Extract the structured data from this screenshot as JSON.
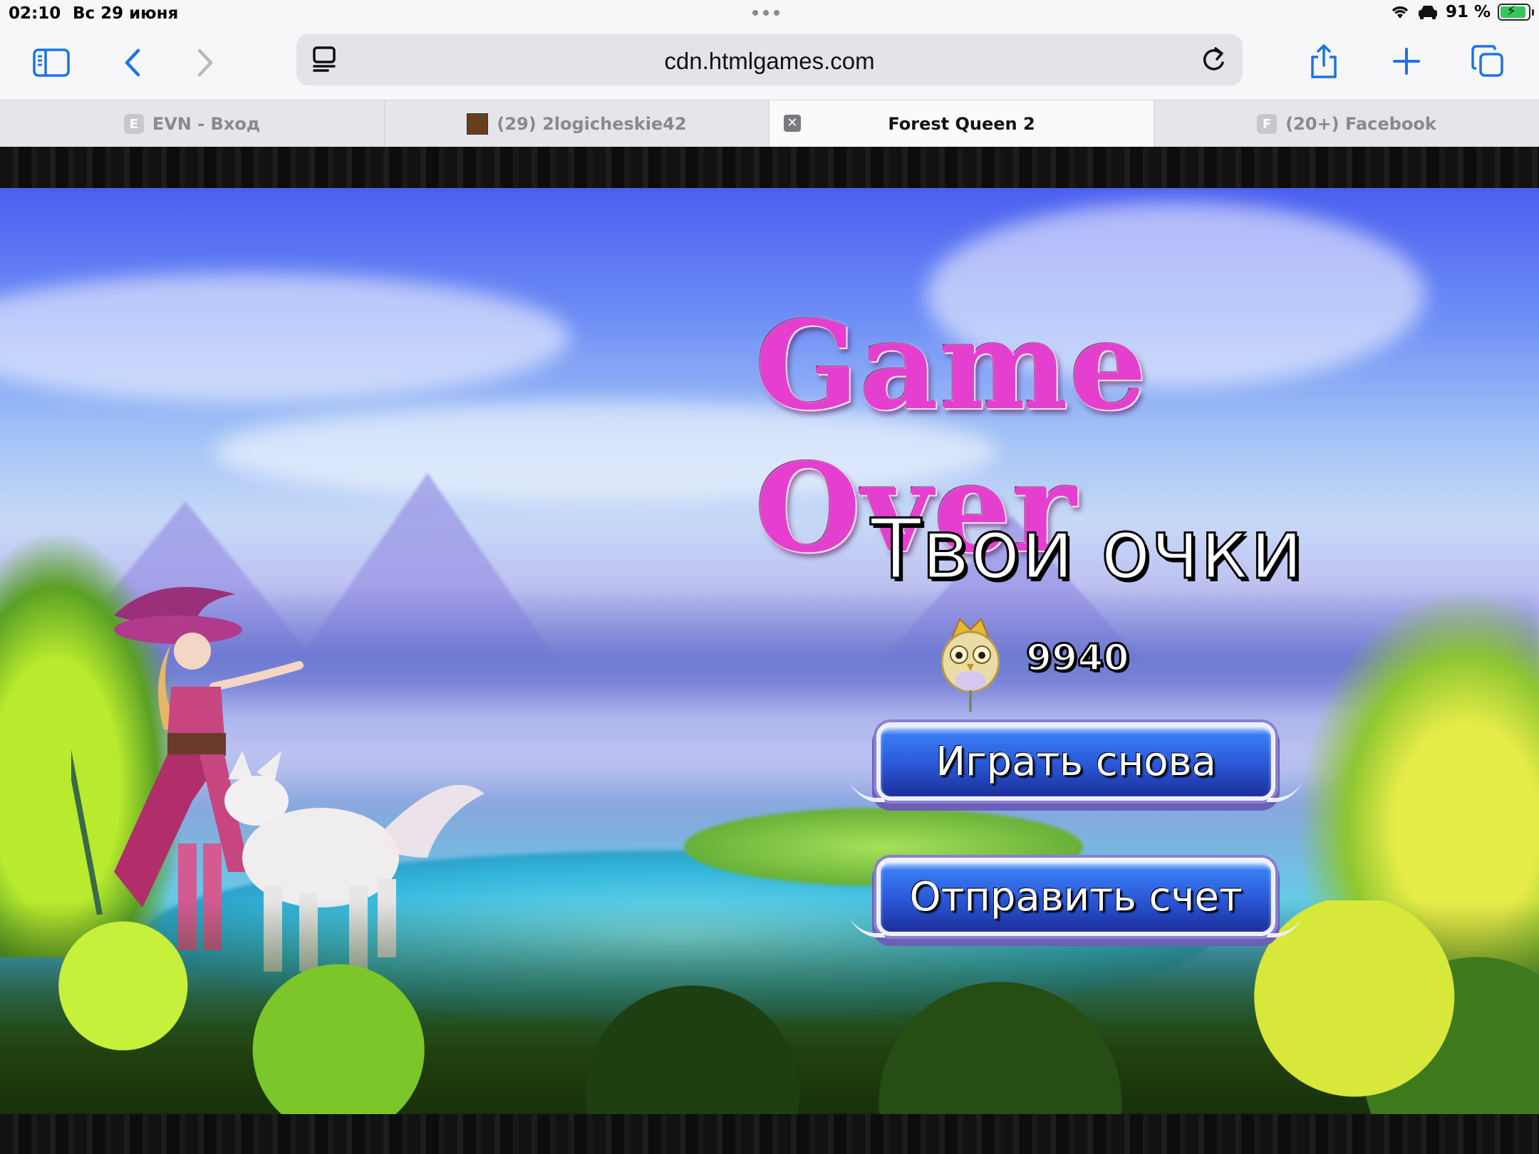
{
  "status_bar": {
    "time": "02:10",
    "date": "Вс 29 июня",
    "battery_percent": "91 %",
    "battery_level": 0.91,
    "icons": [
      "wifi-icon",
      "car-icon",
      "battery-charging-icon"
    ]
  },
  "toolbar": {
    "url": "cdn.htmlgames.com",
    "icons": [
      "sidebar-icon",
      "back-icon",
      "forward-icon",
      "reader-icon",
      "reload-icon",
      "share-icon",
      "plus-icon",
      "tabs-icon"
    ],
    "accent_color": "#1a73e8"
  },
  "tabs": [
    {
      "favicon_letter": "E",
      "label": "EVN - Вход",
      "active": false
    },
    {
      "favicon_letter": "",
      "label": "(29) 2logicheskie42",
      "active": false
    },
    {
      "favicon_letter": "",
      "label": "Forest Queen 2",
      "active": true
    },
    {
      "favicon_letter": "F",
      "label": "(20+) Facebook",
      "active": false
    }
  ],
  "game": {
    "title": "Game Over",
    "score_heading": "Твои очки",
    "score_value": "9940",
    "play_again_label": "Играть снова",
    "submit_score_label": "Отправить счет",
    "title_color": "#e53fd0",
    "button_color": "#2a57d6"
  }
}
